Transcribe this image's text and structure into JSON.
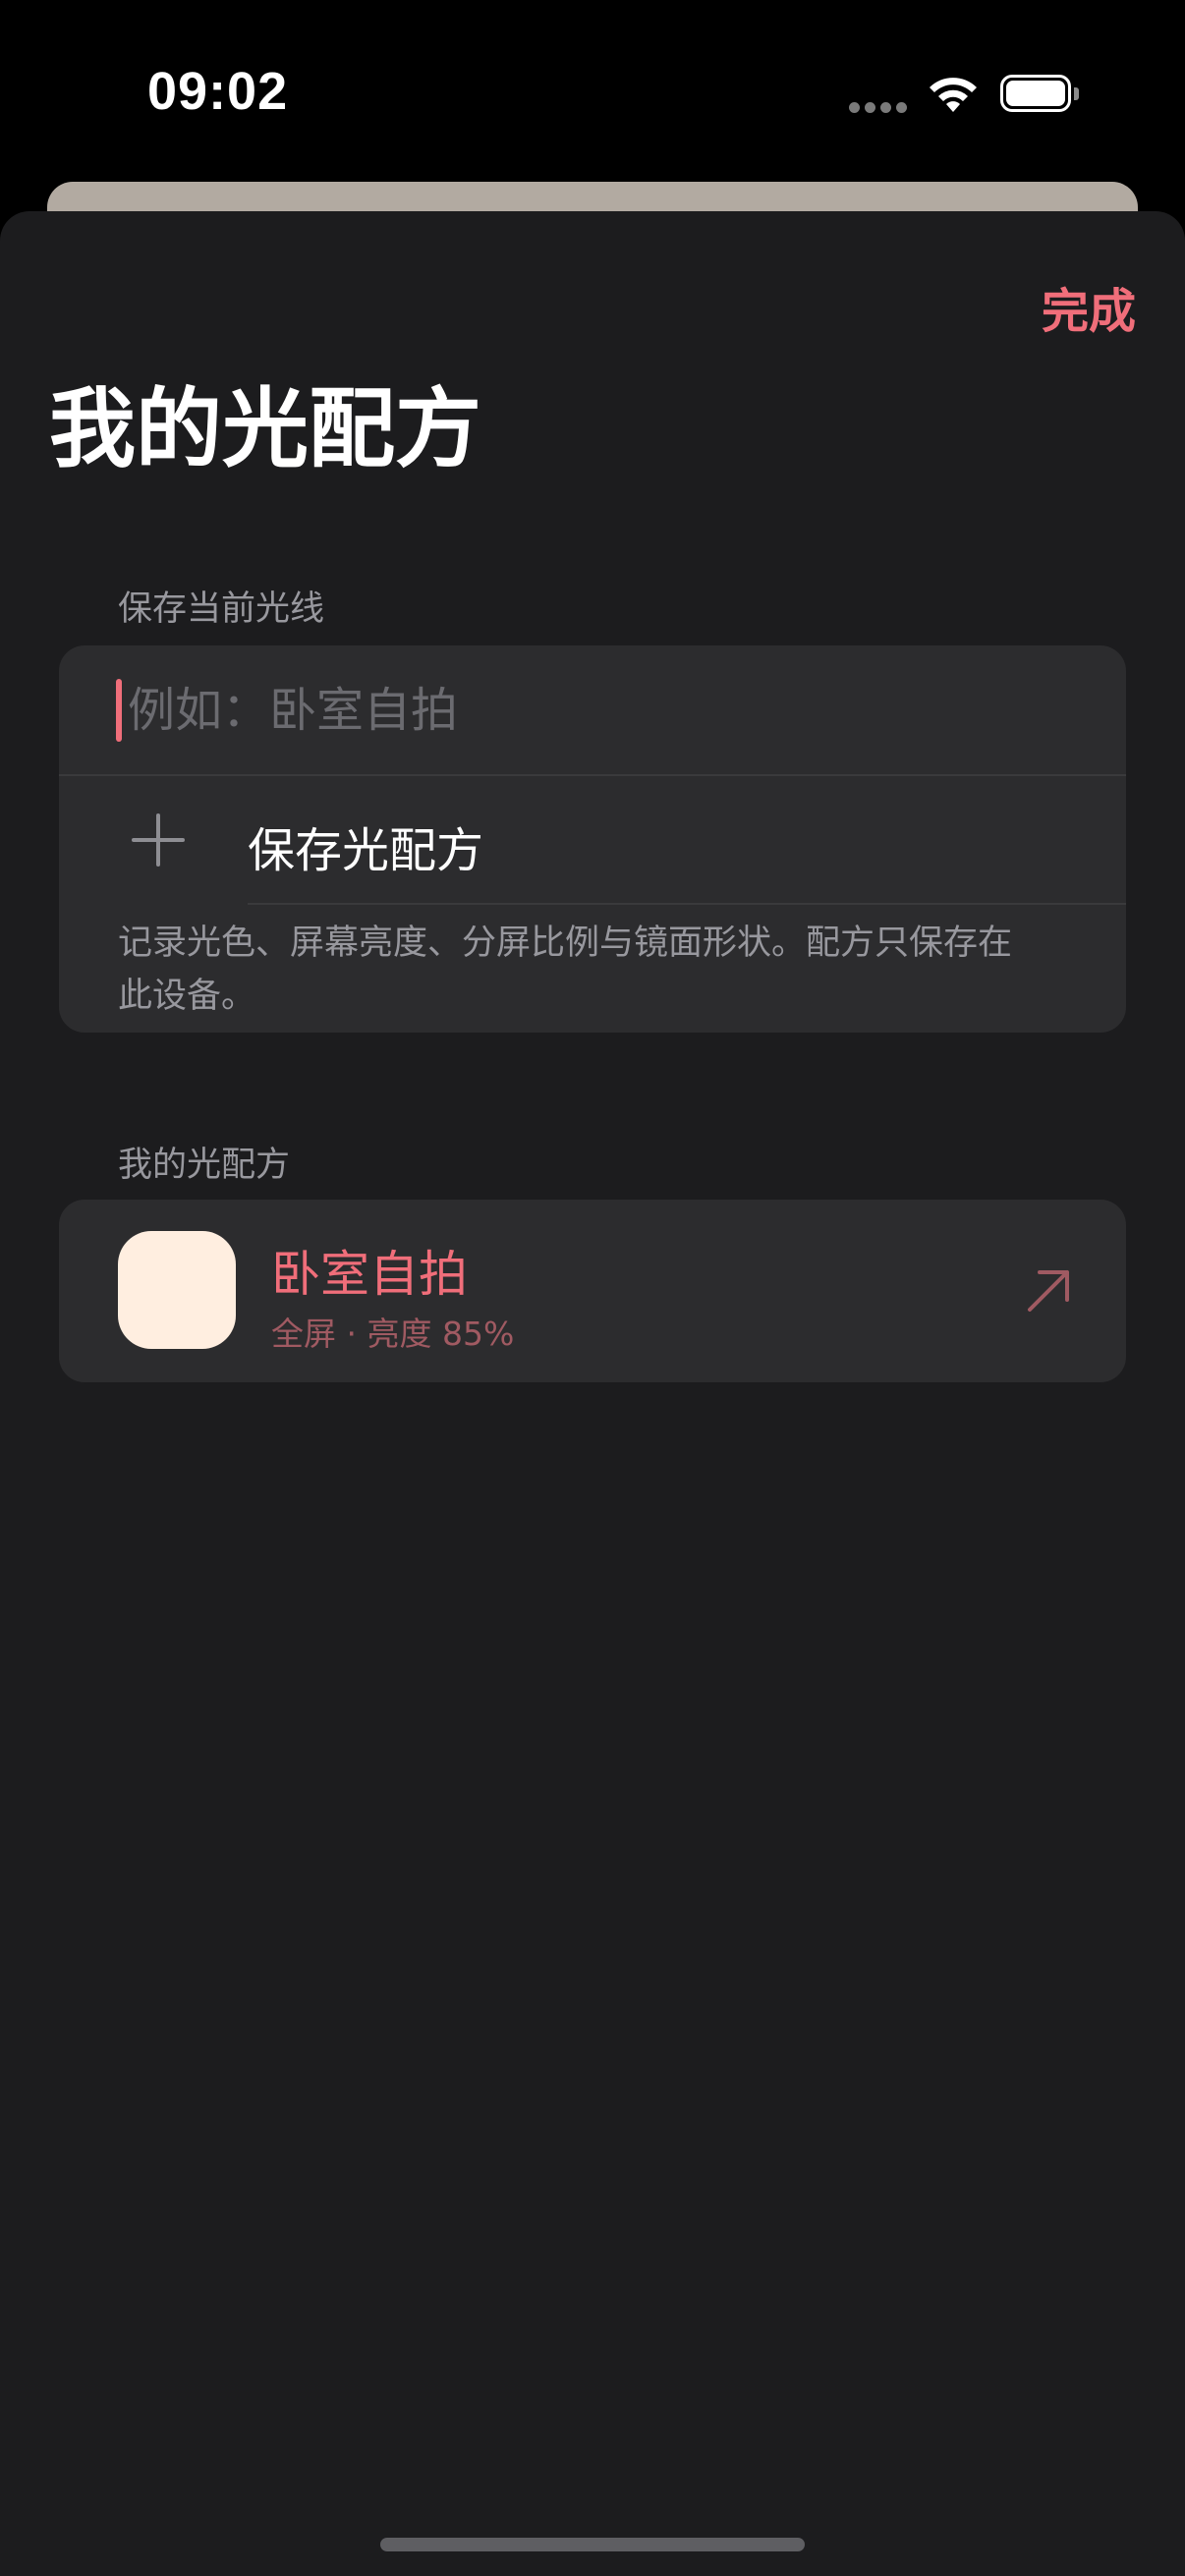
{
  "status_bar": {
    "time": "09:02",
    "signal_icon": "cellular-signal-icon",
    "wifi_icon": "wifi-icon",
    "battery_icon": "battery-icon"
  },
  "header": {
    "done_label": "完成",
    "title": "我的光配方"
  },
  "save_section": {
    "header": "保存当前光线",
    "name_input": {
      "value": "",
      "placeholder": "例如：卧室自拍"
    },
    "save_button_label": "保存光配方",
    "save_icon": "plus-icon",
    "footnote": "记录光色、屏幕亮度、分屏比例与镜面形状。配方只保存在此设备。"
  },
  "recipes_section": {
    "header": "我的光配方",
    "items": [
      {
        "name": "卧室自拍",
        "detail": "全屏 · 亮度 85%",
        "swatch_color": "#ffeee0",
        "action_icon": "arrow-up-right-icon"
      }
    ]
  },
  "colors": {
    "accent": "#f06e7a",
    "sheet_background": "#1c1c1e",
    "group_background": "#2c2c2e"
  }
}
